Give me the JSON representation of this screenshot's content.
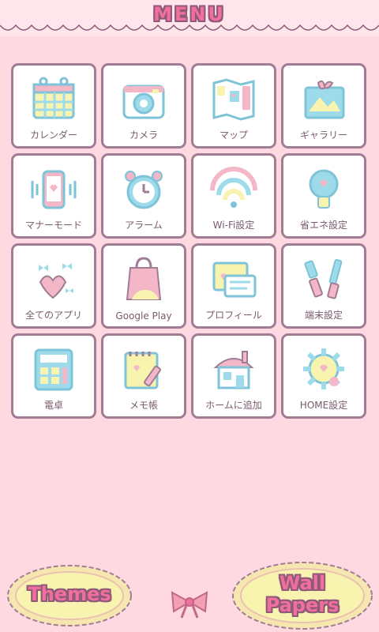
{
  "header": {
    "title": "MENU"
  },
  "tiles": [
    {
      "label": "カレンダー",
      "icon": "calendar-icon"
    },
    {
      "label": "カメラ",
      "icon": "camera-icon"
    },
    {
      "label": "マップ",
      "icon": "map-icon"
    },
    {
      "label": "ギャラリー",
      "icon": "gallery-icon"
    },
    {
      "label": "マナーモード",
      "icon": "phone-vibrate-icon"
    },
    {
      "label": "アラーム",
      "icon": "alarm-clock-icon"
    },
    {
      "label": "Wi-Fi設定",
      "icon": "wifi-icon"
    },
    {
      "label": "省エネ設定",
      "icon": "lightbulb-icon"
    },
    {
      "label": "全てのアプリ",
      "icon": "hearts-icon"
    },
    {
      "label": "Google Play",
      "icon": "shopping-bag-icon"
    },
    {
      "label": "プロフィール",
      "icon": "profile-card-icon"
    },
    {
      "label": "端末設定",
      "icon": "tools-icon"
    },
    {
      "label": "電卓",
      "icon": "calculator-icon"
    },
    {
      "label": "メモ帳",
      "icon": "notepad-icon"
    },
    {
      "label": "ホームに追加",
      "icon": "house-icon"
    },
    {
      "label": "HOME設定",
      "icon": "gear-icon"
    }
  ],
  "bottom": {
    "themes_label": "Themes",
    "wallpapers_line1": "Wall",
    "wallpapers_line2": "Papers"
  },
  "colors": {
    "background": "#ffd9e1",
    "tile_border": "#a07d94",
    "accent_pink": "#f06f9d",
    "icon_blue": "#9ddbea",
    "icon_yellow": "#f8f4b0"
  }
}
